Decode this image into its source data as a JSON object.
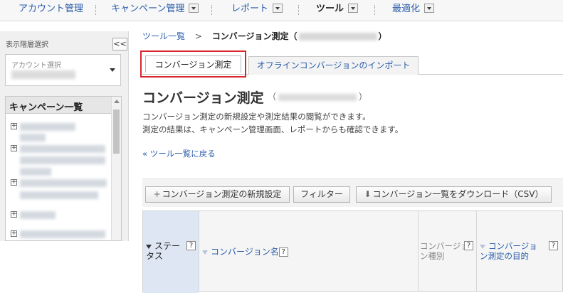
{
  "topnav": {
    "items": [
      {
        "label": "アカウント管理"
      },
      {
        "label": "キャンペーン管理"
      },
      {
        "label": "レポート"
      },
      {
        "label": "ツール"
      },
      {
        "label": "最適化"
      }
    ]
  },
  "sidebar": {
    "title": "表示階層選択",
    "collapse": "<<",
    "account_label": "アカウント選択",
    "campaign_header": "キャンペーン一覧",
    "tree_expand": "+"
  },
  "breadcrumb": {
    "root": "ツール一覧",
    "arrow": ">",
    "current": "コンバージョン測定（",
    "close": "）"
  },
  "tabs": {
    "active": "コンバージョン測定",
    "second": "オフラインコンバージョンのインポート"
  },
  "main": {
    "title": "コンバージョン測定",
    "paren_open": "（",
    "paren_close": "）",
    "desc_line1": "コンバージョン測定の新規設定や測定結果の閲覧ができます。",
    "desc_line2": "測定の結果は、キャンペーン管理画面、レポートからも確認できます。",
    "back_link": "« ツール一覧に戻る"
  },
  "toolbar": {
    "new_label": "コンバージョン測定の新規設定",
    "new_icon": "+",
    "filter_label": "フィルター",
    "download_label": "コンバージョン一覧をダウンロード（CSV）",
    "download_icon": "⬇"
  },
  "table": {
    "status_line1": "ステー",
    "status_line2": "タス",
    "name": "コンバージョン名",
    "type_line1": "コンバージョ",
    "type_line2": "ン種別",
    "purpose_line1": "コンバージョ",
    "purpose_line2": "ン測定の目的",
    "help": "?"
  }
}
